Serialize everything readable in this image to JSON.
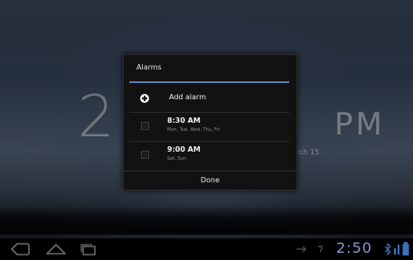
{
  "lockscreen": {
    "clock_partial": "2",
    "clock_right_partial": "",
    "ampm": "PM",
    "date_fragment": "rch 15"
  },
  "dialog": {
    "title": "Alarms",
    "add_label": "Add alarm",
    "alarms": [
      {
        "time": "8:30 AM",
        "days": "Mon, Tue, Wed, Thu, Fri",
        "enabled": false
      },
      {
        "time": "9:00 AM",
        "days": "Sat, Sun",
        "enabled": false
      }
    ],
    "done_label": "Done"
  },
  "status_bar": {
    "time": "2:50",
    "accent_color": "#7d9fd4"
  },
  "icons": {
    "back": "back-icon",
    "home": "home-icon",
    "recent": "recent-apps-icon",
    "add": "add-icon",
    "usb": "usb-icon",
    "notification": "notification-icon",
    "bluetooth": "bluetooth-icon",
    "wifi": "wifi-icon",
    "battery": "battery-icon"
  }
}
